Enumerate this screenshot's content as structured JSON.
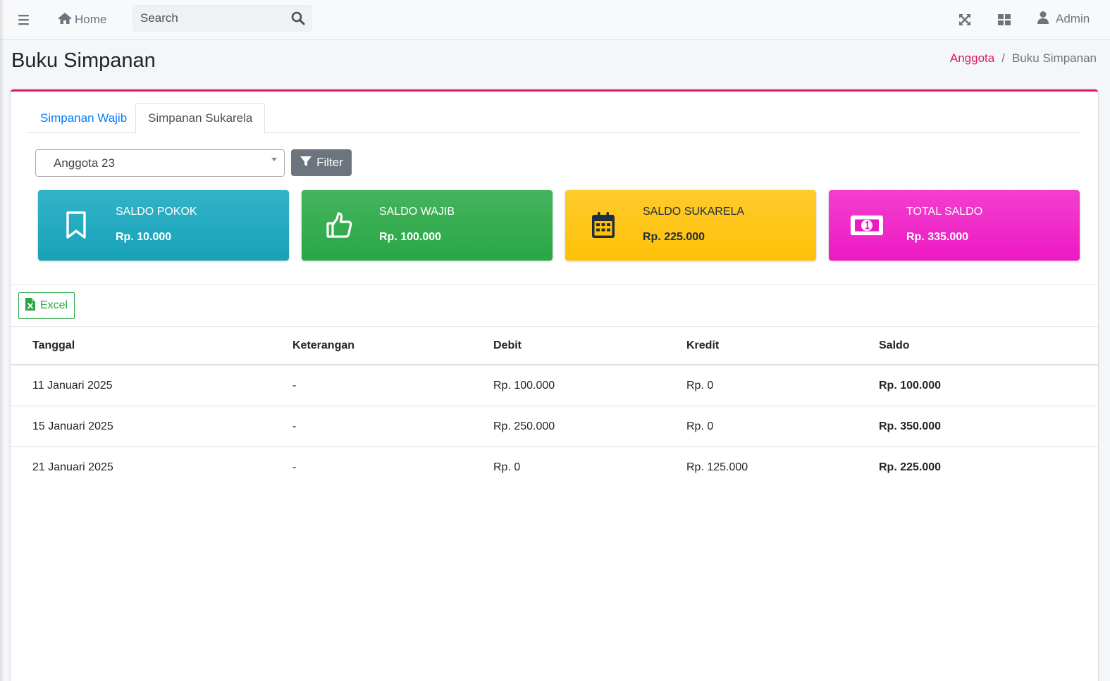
{
  "navbar": {
    "home_label": "Home",
    "search_placeholder": "Search",
    "user_label": "Admin"
  },
  "header": {
    "title": "Buku Simpanan",
    "breadcrumb": [
      "Anggota",
      "/",
      "Buku Simpanan"
    ]
  },
  "tabs": [
    {
      "label": "Simpanan Wajib"
    },
    {
      "label": "Simpanan Sukarela",
      "active": true
    }
  ],
  "filter": {
    "selected_member": "Anggota 23",
    "button_label": "Filter"
  },
  "info_boxes": [
    {
      "label": "SALDO POKOK",
      "value": "Rp. 10.000",
      "icon": "bookmark-icon",
      "color": "#17a2b8"
    },
    {
      "label": "SALDO WAJIB",
      "value": "Rp. 100.000",
      "icon": "thumbs-up-icon",
      "color": "#28a745"
    },
    {
      "label": "SALDO SUKARELA",
      "value": "Rp. 225.000",
      "icon": "calendar-icon",
      "color": "#ffc107"
    },
    {
      "label": "TOTAL SALDO",
      "value": "Rp. 335.000",
      "icon": "money-bill-icon",
      "color": "#ed19c3"
    }
  ],
  "export": {
    "excel_label": "Excel"
  },
  "table": {
    "headers": [
      "Tanggal",
      "Keterangan",
      "Debit",
      "Kredit",
      "Saldo"
    ],
    "rows": [
      [
        "11 Januari 2025",
        "-",
        "Rp. 100.000",
        "Rp. 0",
        "Rp. 100.000"
      ],
      [
        "15 Januari 2025",
        "-",
        "Rp. 250.000",
        "Rp. 0",
        "Rp. 350.000"
      ],
      [
        "21 Januari 2025",
        "-",
        "Rp. 0",
        "Rp. 125.000",
        "Rp. 225.000"
      ]
    ]
  },
  "colors": {
    "accent": "#e3195f",
    "link": "#007bff",
    "breadcrumb_link": "#dc1e5a"
  }
}
